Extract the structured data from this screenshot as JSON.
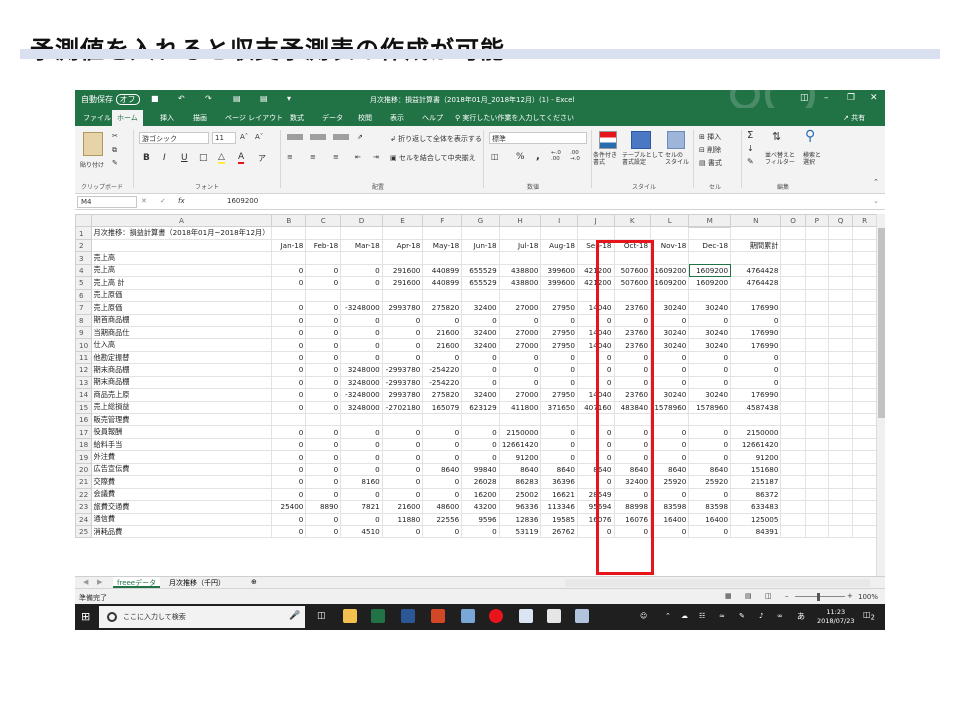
{
  "slide": {
    "title": "予測値を入れると収支予測表の作成が可能"
  },
  "titlebar": {
    "title": "月次推移：損益計算書（2018年01月_2018年12月）(1) - Excel",
    "autosave": "自動保存",
    "autosave_state": "オフ",
    "user": ""
  },
  "tabs": [
    "ファイル",
    "ホーム",
    "挿入",
    "描画",
    "ページ レイアウト",
    "数式",
    "データ",
    "校閲",
    "表示",
    "ヘルプ"
  ],
  "tell_me": "実行したい作業を入力してください",
  "share": "共有",
  "ribbon": {
    "clipboard": {
      "paste": "貼り付け",
      "group": "クリップボード"
    },
    "font": {
      "name": "游ゴシック",
      "size": "11",
      "group": "フォント",
      "bold": "B",
      "italic": "I",
      "underline": "U"
    },
    "alignment": {
      "wrap": "折り返して全体を表示する",
      "merge": "セルを結合して中央揃え",
      "group": "配置"
    },
    "number": {
      "format": "標準",
      "percent": "%",
      "comma": ",",
      "group": "数値"
    },
    "styles": {
      "conditional": "条件付き\n書式",
      "table": "テーブルとして\n書式設定",
      "cell": "セルの\nスタイル",
      "group": "スタイル"
    },
    "cells": {
      "insert": "挿入",
      "delete": "削除",
      "format": "書式",
      "group": "セル"
    },
    "editing": {
      "sortfilter": "並べ替えと\nフィルター",
      "find": "検索と\n選択",
      "group": "編集"
    }
  },
  "formula_bar": {
    "name_box": "M4",
    "fx": "fx",
    "value": "1609200"
  },
  "columns": [
    "A",
    "B",
    "C",
    "D",
    "E",
    "F",
    "G",
    "H",
    "I",
    "J",
    "K",
    "L",
    "M",
    "N",
    "O",
    "P",
    "Q",
    "R"
  ],
  "rows": [
    [
      "月次推移：損益計算書（2018年01月~2018年12月）",
      "",
      "",
      "",
      "",
      "",
      "",
      "",
      "",
      "",
      "",
      "",
      "",
      "",
      "",
      "",
      "",
      ""
    ],
    [
      "",
      "Jan-18",
      "Feb-18",
      "Mar-18",
      "Apr-18",
      "May-18",
      "Jun-18",
      "Jul-18",
      "Aug-18",
      "Sep-18",
      "Oct-18",
      "Nov-18",
      "Dec-18",
      "期間累計",
      "",
      "",
      "",
      ""
    ],
    [
      "売上高",
      "",
      "",
      "",
      "",
      "",
      "",
      "",
      "",
      "",
      "",
      "",
      "",
      "",
      "",
      "",
      "",
      ""
    ],
    [
      "売上高",
      "0",
      "0",
      "0",
      "291600",
      "440899",
      "655529",
      "438800",
      "399600",
      "421200",
      "507600",
      "1609200",
      "1609200",
      "4764428",
      "",
      "",
      "",
      ""
    ],
    [
      "売上高 計",
      "0",
      "0",
      "0",
      "291600",
      "440899",
      "655529",
      "438800",
      "399600",
      "421200",
      "507600",
      "1609200",
      "1609200",
      "4764428",
      "",
      "",
      "",
      ""
    ],
    [
      "売上原価",
      "",
      "",
      "",
      "",
      "",
      "",
      "",
      "",
      "",
      "",
      "",
      "",
      "",
      "",
      "",
      "",
      ""
    ],
    [
      "売上原価",
      "0",
      "0",
      "-3248000",
      "2993780",
      "275820",
      "32400",
      "27000",
      "27950",
      "14040",
      "23760",
      "30240",
      "30240",
      "176990",
      "",
      "",
      "",
      ""
    ],
    [
      "期首商品棚",
      "0",
      "0",
      "0",
      "0",
      "0",
      "0",
      "0",
      "0",
      "0",
      "0",
      "0",
      "0",
      "0",
      "",
      "",
      "",
      ""
    ],
    [
      "当期商品仕",
      "0",
      "0",
      "0",
      "0",
      "21600",
      "32400",
      "27000",
      "27950",
      "14040",
      "23760",
      "30240",
      "30240",
      "176990",
      "",
      "",
      "",
      ""
    ],
    [
      "仕入高",
      "0",
      "0",
      "0",
      "0",
      "21600",
      "32400",
      "27000",
      "27950",
      "14040",
      "23760",
      "30240",
      "30240",
      "176990",
      "",
      "",
      "",
      ""
    ],
    [
      "他勘定振替",
      "0",
      "0",
      "0",
      "0",
      "0",
      "0",
      "0",
      "0",
      "0",
      "0",
      "0",
      "0",
      "0",
      "",
      "",
      "",
      ""
    ],
    [
      "期末商品棚",
      "0",
      "0",
      "3248000",
      "-2993780",
      "-254220",
      "0",
      "0",
      "0",
      "0",
      "0",
      "0",
      "0",
      "0",
      "",
      "",
      "",
      ""
    ],
    [
      "期末商品棚",
      "0",
      "0",
      "3248000",
      "-2993780",
      "-254220",
      "0",
      "0",
      "0",
      "0",
      "0",
      "0",
      "0",
      "0",
      "",
      "",
      "",
      ""
    ],
    [
      "商品売上原",
      "0",
      "0",
      "-3248000",
      "2993780",
      "275820",
      "32400",
      "27000",
      "27950",
      "14040",
      "23760",
      "30240",
      "30240",
      "176990",
      "",
      "",
      "",
      ""
    ],
    [
      "売上総損益",
      "0",
      "0",
      "3248000",
      "-2702180",
      "165079",
      "623129",
      "411800",
      "371650",
      "407160",
      "483840",
      "1578960",
      "1578960",
      "4587438",
      "",
      "",
      "",
      ""
    ],
    [
      "販売管理費",
      "",
      "",
      "",
      "",
      "",
      "",
      "",
      "",
      "",
      "",
      "",
      "",
      "",
      "",
      "",
      "",
      ""
    ],
    [
      "役員報酬",
      "0",
      "0",
      "0",
      "0",
      "0",
      "0",
      "2150000",
      "0",
      "0",
      "0",
      "0",
      "0",
      "2150000",
      "",
      "",
      "",
      ""
    ],
    [
      "給料手当",
      "0",
      "0",
      "0",
      "0",
      "0",
      "0",
      "12661420",
      "0",
      "0",
      "0",
      "0",
      "0",
      "12661420",
      "",
      "",
      "",
      ""
    ],
    [
      "外注費",
      "0",
      "0",
      "0",
      "0",
      "0",
      "0",
      "91200",
      "0",
      "0",
      "0",
      "0",
      "0",
      "91200",
      "",
      "",
      "",
      ""
    ],
    [
      "広告宣伝費",
      "0",
      "0",
      "0",
      "0",
      "8640",
      "99840",
      "8640",
      "8640",
      "8640",
      "8640",
      "8640",
      "8640",
      "151680",
      "",
      "",
      "",
      ""
    ],
    [
      "交際費",
      "0",
      "0",
      "8160",
      "0",
      "0",
      "26028",
      "86283",
      "36396",
      "0",
      "32400",
      "25920",
      "25920",
      "215187",
      "",
      "",
      "",
      ""
    ],
    [
      "会議費",
      "0",
      "0",
      "0",
      "0",
      "0",
      "16200",
      "25002",
      "16621",
      "28549",
      "0",
      "0",
      "0",
      "86372",
      "",
      "",
      "",
      ""
    ],
    [
      "旅費交通費",
      "25400",
      "8890",
      "7821",
      "21600",
      "48600",
      "43200",
      "96336",
      "113346",
      "95694",
      "88998",
      "83598",
      "83598",
      "633483",
      "",
      "",
      "",
      ""
    ],
    [
      "通信費",
      "0",
      "0",
      "0",
      "11880",
      "22556",
      "9596",
      "12836",
      "19585",
      "16076",
      "16076",
      "16400",
      "16400",
      "125005",
      "",
      "",
      "",
      ""
    ],
    [
      "消耗品費",
      "0",
      "0",
      "4510",
      "0",
      "0",
      "0",
      "53119",
      "26762",
      "0",
      "0",
      "0",
      "0",
      "84391",
      "",
      "",
      "",
      ""
    ]
  ],
  "sheet_tabs": [
    "freeeデータ",
    "月次推移（千円）"
  ],
  "status": {
    "ready": "準備完了",
    "zoom": "100%"
  },
  "taskbar": {
    "search": "ここに入力して検索",
    "time": "11:23",
    "date": "2018/07/23",
    "ime": "あ",
    "notif": "2"
  }
}
